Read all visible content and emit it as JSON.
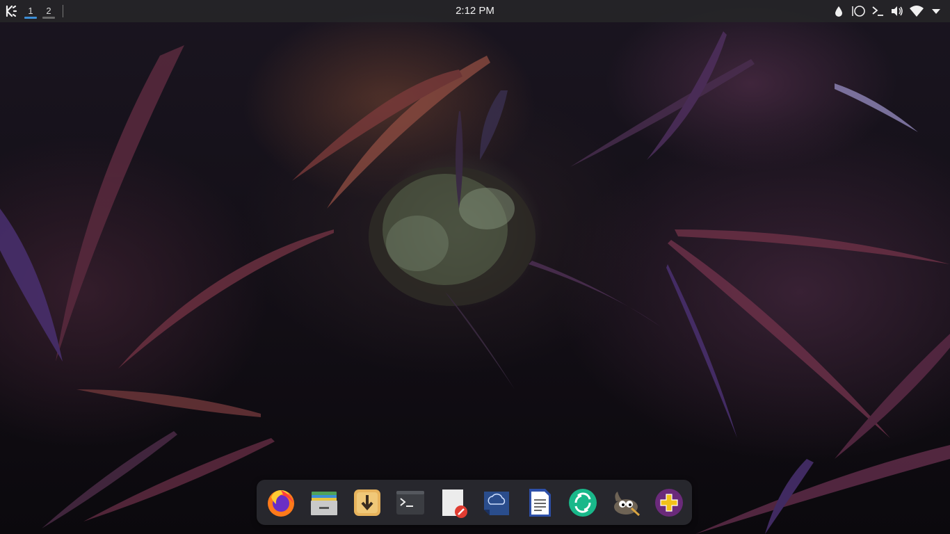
{
  "top_panel": {
    "app_launcher_icon": "kde-logo-icon",
    "pager": [
      {
        "label": "1",
        "active": true
      },
      {
        "label": "2",
        "active": false
      }
    ],
    "clock": "2:12 PM",
    "tray_icons": [
      "ink-drop-icon",
      "circle-icon",
      "terminal-prompt-icon",
      "volume-icon",
      "wifi-icon",
      "chevron-down-icon"
    ]
  },
  "dock": {
    "items": [
      {
        "name": "firefox-icon"
      },
      {
        "name": "file-manager-icon"
      },
      {
        "name": "download-manager-icon"
      },
      {
        "name": "terminal-icon"
      },
      {
        "name": "text-editor-icon"
      },
      {
        "name": "cloud-sync-icon"
      },
      {
        "name": "document-viewer-icon"
      },
      {
        "name": "element-chat-icon"
      },
      {
        "name": "gimp-icon"
      },
      {
        "name": "add-app-icon"
      }
    ]
  },
  "colors": {
    "panel_bg": "#262628",
    "pager_active": "#3d8fd6",
    "dock_bg": "#2d2d32"
  }
}
